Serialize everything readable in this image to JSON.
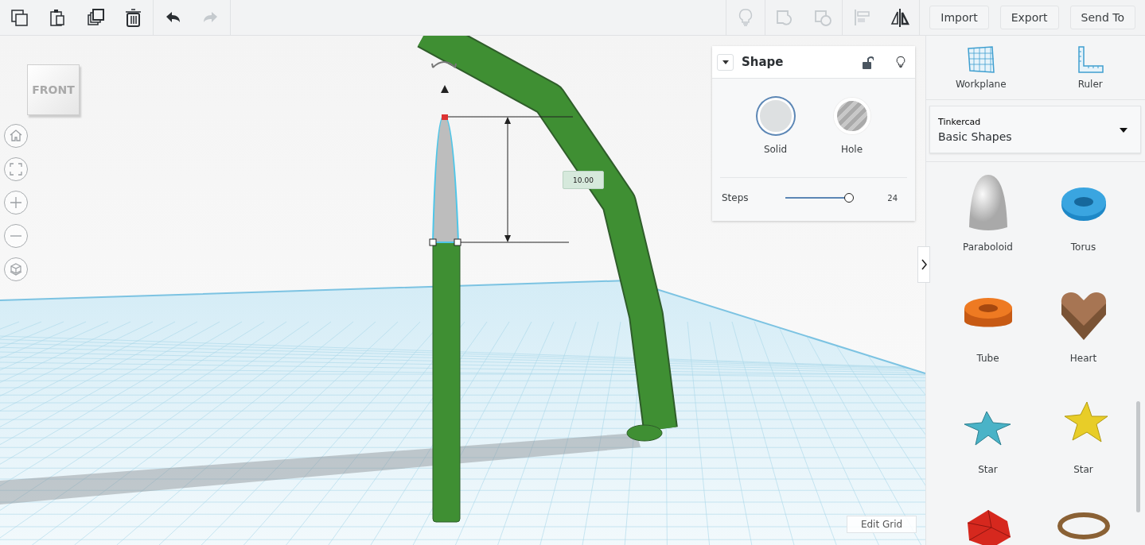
{
  "toolbar": {
    "left_groups": [
      [
        {
          "kind": "copy",
          "disabled": false
        },
        {
          "kind": "paste",
          "disabled": false
        },
        {
          "kind": "duplicate",
          "disabled": false
        },
        {
          "kind": "delete",
          "disabled": false
        }
      ],
      [
        {
          "kind": "undo",
          "disabled": false
        },
        {
          "kind": "redo",
          "disabled": true
        }
      ]
    ],
    "right_groups": [
      [
        {
          "kind": "bulb",
          "disabled": true
        }
      ],
      [
        {
          "kind": "group",
          "disabled": true
        },
        {
          "kind": "ungroup",
          "disabled": true
        }
      ],
      [
        {
          "kind": "align",
          "disabled": true
        },
        {
          "kind": "mirror",
          "disabled": false
        }
      ]
    ],
    "buttons": [
      "Import",
      "Export",
      "Send To"
    ]
  },
  "viewport": {
    "view_cube": "FRONT",
    "controls": [
      {
        "kind": "home"
      },
      {
        "kind": "fit"
      },
      {
        "kind": "zoom-in"
      },
      {
        "kind": "zoom-out"
      },
      {
        "kind": "perspective"
      }
    ],
    "dimension": "10.00",
    "edit_grid": "Edit Grid"
  },
  "shape_panel": {
    "title": "Shape",
    "locked": false,
    "options": [
      {
        "label": "Solid",
        "kind": "solid",
        "selected": true
      },
      {
        "label": "Hole",
        "kind": "hole",
        "selected": false
      }
    ],
    "steps": {
      "label": "Steps",
      "level": 1.0,
      "reading": "24"
    }
  },
  "sidebar": {
    "tools": [
      {
        "label": "Workplane",
        "kind": "workplane"
      },
      {
        "label": "Ruler",
        "kind": "ruler"
      }
    ],
    "library": {
      "caption": "Tinkercad",
      "value": "Basic Shapes"
    },
    "shapes": [
      {
        "label": "Paraboloid",
        "kind": "paraboloid"
      },
      {
        "label": "Torus",
        "kind": "torus"
      },
      {
        "label": "Tube",
        "kind": "tube"
      },
      {
        "label": "Heart",
        "kind": "heart"
      },
      {
        "label": "Star",
        "kind": "star-teal"
      },
      {
        "label": "Star",
        "kind": "star-yellow"
      },
      {
        "kind": "icosahedron"
      },
      {
        "kind": "ring"
      }
    ]
  }
}
